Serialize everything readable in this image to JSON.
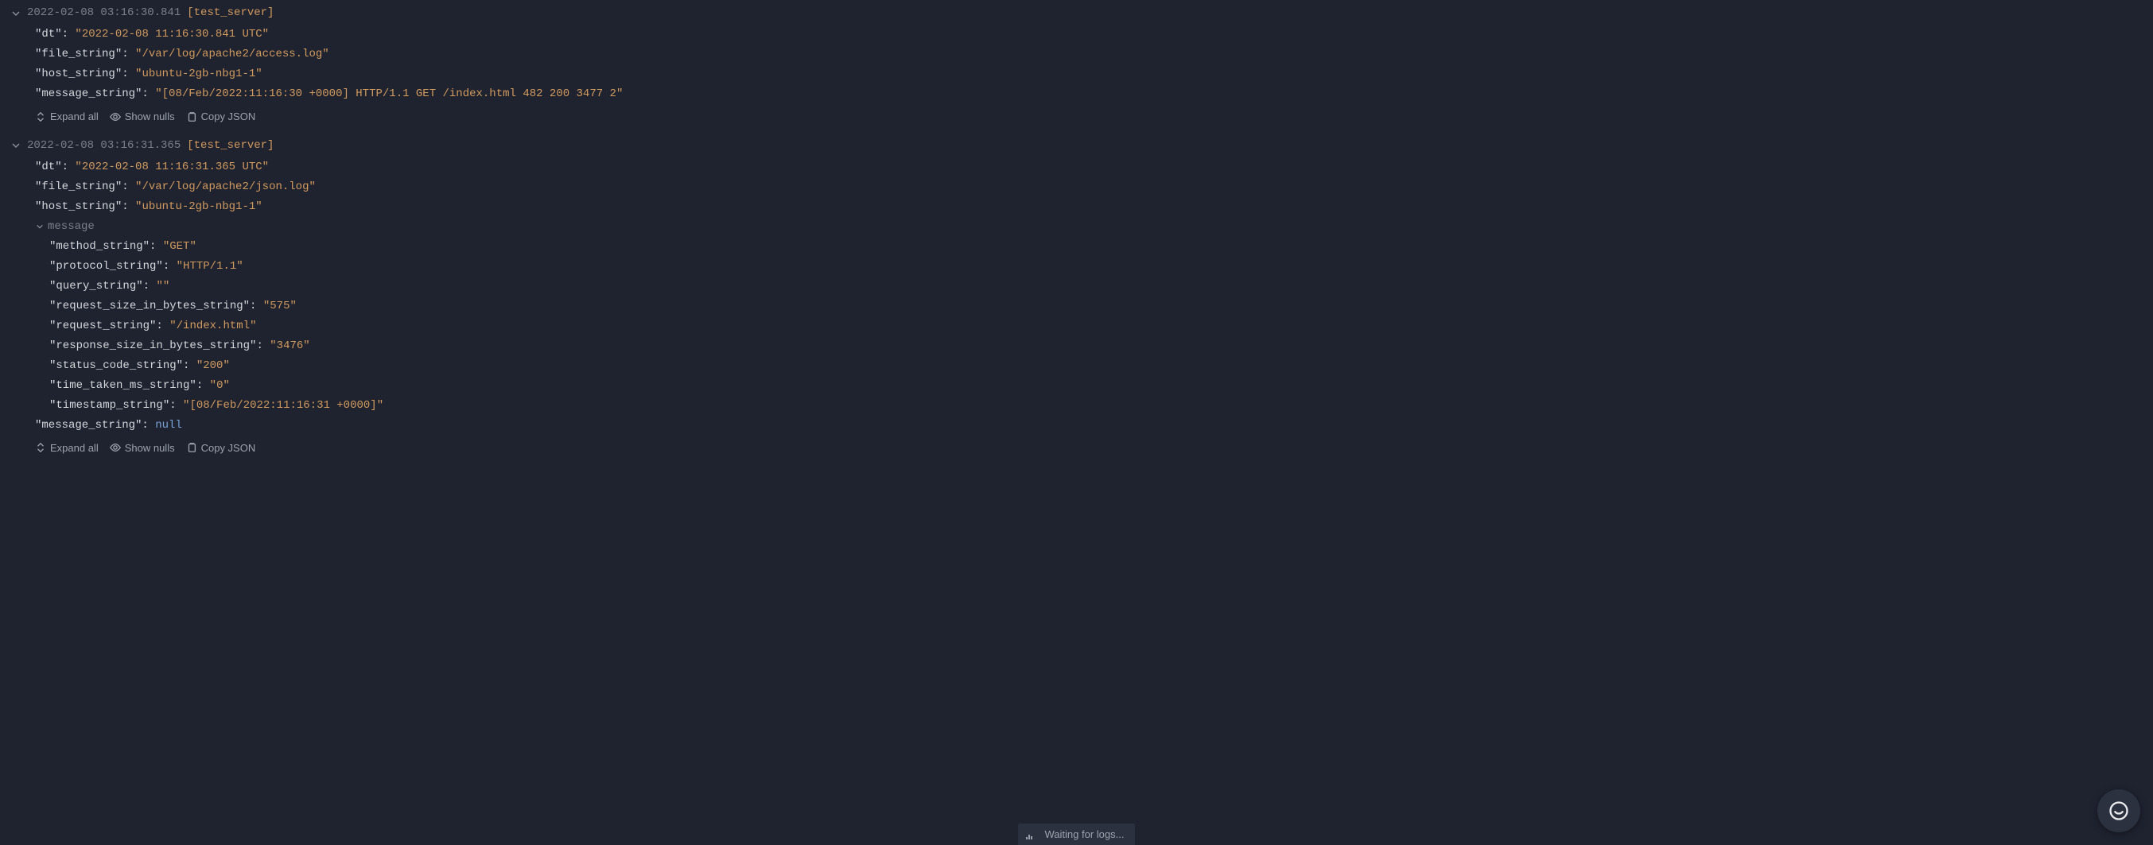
{
  "actions": {
    "expand_all": "Expand all",
    "show_nulls": "Show nulls",
    "copy_json": "Copy JSON"
  },
  "status": {
    "text": "Waiting for logs..."
  },
  "log_entries": [
    {
      "timestamp": "2022-02-08 03:16:30.841",
      "source": "[test_server]",
      "fields": {
        "dt": "2022-02-08 11:16:30.841 UTC",
        "file_string": "/var/log/apache2/access.log",
        "host_string": "ubuntu-2gb-nbg1-1",
        "message_string": "[08/Feb/2022:11:16:30 +0000] HTTP/1.1 GET /index.html 482 200 3477 2"
      }
    },
    {
      "timestamp": "2022-02-08 03:16:31.365",
      "source": "[test_server]",
      "fields": {
        "dt": "2022-02-08 11:16:31.365 UTC",
        "file_string": "/var/log/apache2/json.log",
        "host_string": "ubuntu-2gb-nbg1-1"
      },
      "nested_key": "message",
      "nested_fields": {
        "method_string": "GET",
        "protocol_string": "HTTP/1.1",
        "query_string": "",
        "request_size_in_bytes_string": "575",
        "request_string": "/index.html",
        "response_size_in_bytes_string": "3476",
        "status_code_string": "200",
        "time_taken_ms_string": "0",
        "timestamp_string": "[08/Feb/2022:11:16:31 +0000]"
      },
      "null_fields": {
        "message_string": "null"
      }
    }
  ]
}
